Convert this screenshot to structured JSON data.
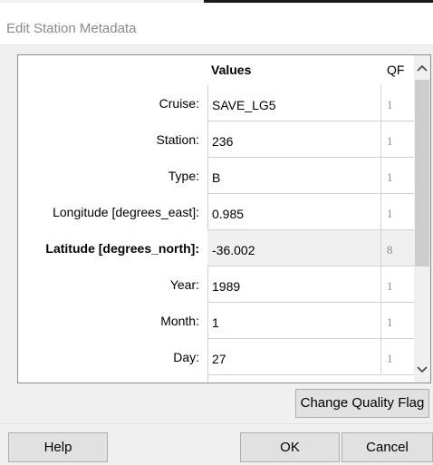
{
  "window": {
    "title": "Edit Station Metadata"
  },
  "table": {
    "headers": {
      "values": "Values",
      "qf": "QF"
    },
    "rows": [
      {
        "label": "Cruise:",
        "value": "SAVE_LG5",
        "qf": "1"
      },
      {
        "label": "Station:",
        "value": "236",
        "qf": "1"
      },
      {
        "label": "Type:",
        "value": "B",
        "qf": "1"
      },
      {
        "label": "Longitude [degrees_east]:",
        "value": "0.985",
        "qf": "1"
      },
      {
        "label": "Latitude [degrees_north]:",
        "value": "-36.002",
        "qf": "8"
      },
      {
        "label": "Year:",
        "value": "1989",
        "qf": "1"
      },
      {
        "label": "Month:",
        "value": "1",
        "qf": "1"
      },
      {
        "label": "Day:",
        "value": "27",
        "qf": "1"
      }
    ],
    "selected_row": 4,
    "scroll_up_icon": "chevron-up-icon",
    "scroll_down_icon": "chevron-down-icon"
  },
  "buttons": {
    "change_quality_flag": "Change Quality Flag",
    "help": "Help",
    "ok": "OK",
    "cancel": "Cancel"
  }
}
